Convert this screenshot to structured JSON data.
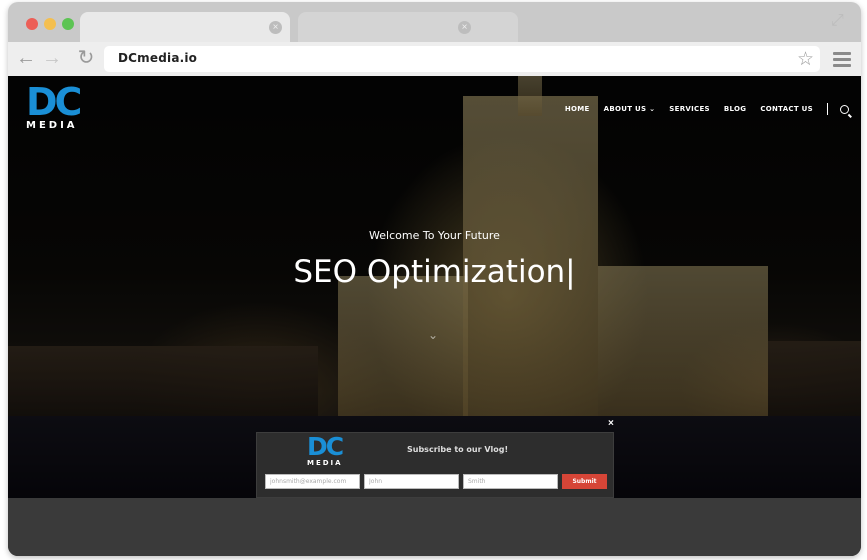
{
  "browser": {
    "url": "DCmedia.io",
    "tab_close_glyph": "×",
    "expand_glyph": "⤢",
    "back_glyph": "←",
    "forward_glyph": "→",
    "reload_glyph": "↻",
    "star_glyph": "☆"
  },
  "site": {
    "logo": {
      "letters": "DC",
      "word": "MEDIA",
      "color": "#1a8fd6"
    },
    "nav": {
      "items": [
        "HOME",
        "ABOUT US ⌄",
        "SERVICES",
        "BLOG",
        "CONTACT US"
      ]
    },
    "hero": {
      "welcome": "Welcome To Your Future",
      "headline": "SEO Optimization|",
      "arrow": "⌄"
    },
    "popup": {
      "close": "×",
      "title": "Subscribe to our Vlog!",
      "email_placeholder": "johnsmith@example.com",
      "first_placeholder": "John",
      "last_placeholder": "Smith",
      "submit_label": "Submit",
      "submit_color": "#d64537"
    }
  }
}
